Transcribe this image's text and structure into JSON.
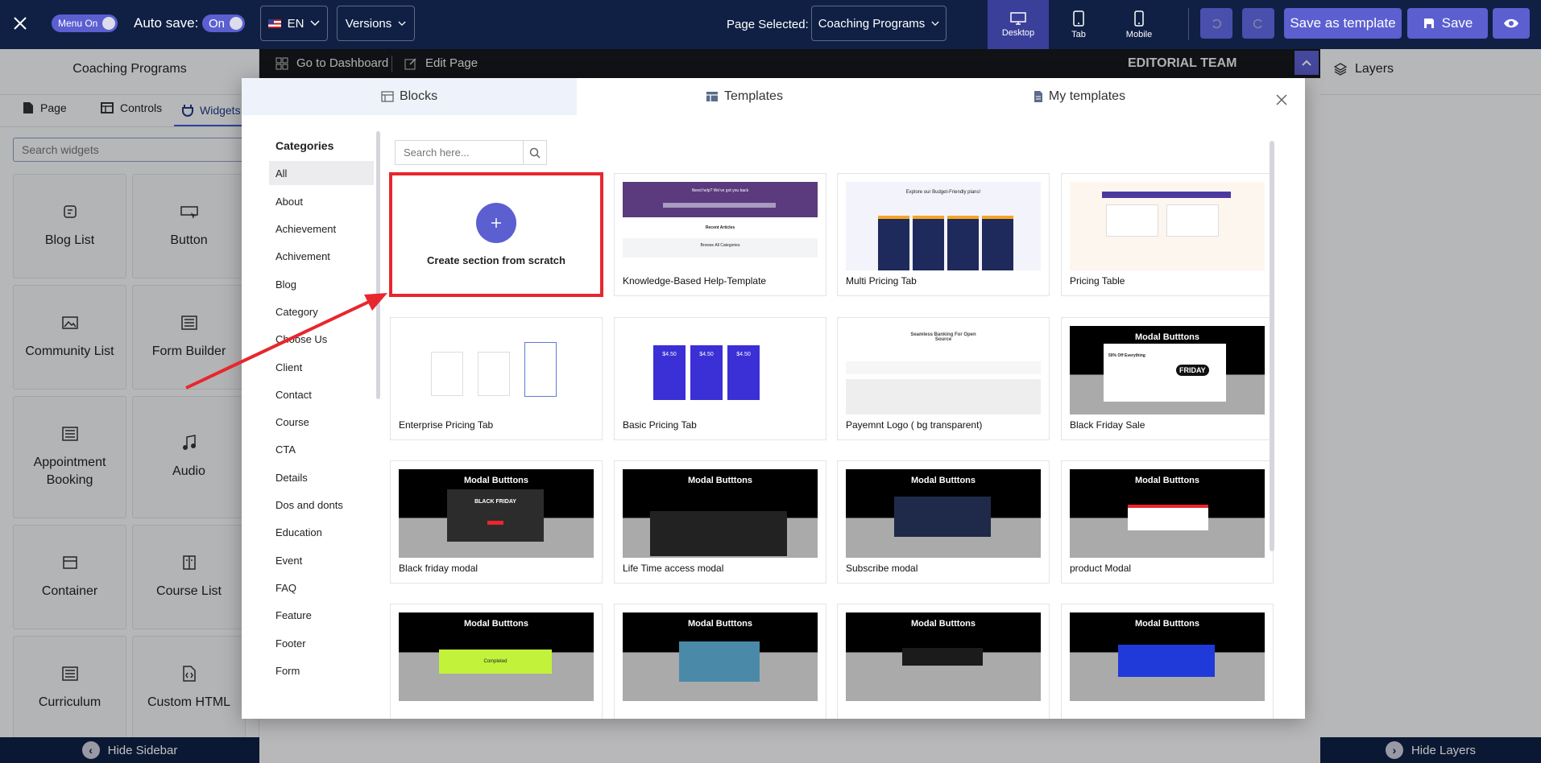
{
  "topbar": {
    "menu_on": "Menu On",
    "auto_save": "Auto save:",
    "on": "On",
    "lang": "EN",
    "versions": "Versions",
    "page_selected": "Page Selected:",
    "page_name": "Coaching Programs",
    "desktop": "Desktop",
    "tab": "Tab",
    "mobile": "Mobile",
    "save_template": "Save as template",
    "save": "Save"
  },
  "sidebar": {
    "title": "Coaching Programs",
    "tabs": [
      "Page",
      "Controls",
      "Widgets"
    ],
    "search_placeholder": "Search widgets",
    "widgets": [
      "Blog List",
      "Button",
      "Community List",
      "Form Builder",
      "Appointment Booking",
      "Audio",
      "Container",
      "Course List",
      "Curriculum",
      "Custom HTML"
    ],
    "hide": "Hide Sidebar"
  },
  "editor": {
    "dashboard": "Go to Dashboard",
    "edit": "Edit Page",
    "brand": "EDITORIAL TEAM"
  },
  "right": {
    "layers": "Layers",
    "hide": "Hide Layers"
  },
  "modal": {
    "tabs": [
      "Blocks",
      "Templates",
      "My templates"
    ],
    "categories_title": "Categories",
    "categories": [
      "All",
      "About",
      "Achievement",
      "Achivement",
      "Blog",
      "Category",
      "Choose Us",
      "Client",
      "Contact",
      "Course",
      "CTA",
      "Details",
      "Dos and donts",
      "Education",
      "Event",
      "FAQ",
      "Feature",
      "Footer",
      "Form"
    ],
    "search_placeholder": "Search here...",
    "create": "Create section from scratch",
    "cards": [
      "Knowledge-Based Help-Template",
      "Multi Pricing Tab",
      "Pricing Table",
      "Enterprise Pricing Tab",
      "Basic Pricing Tab",
      "Payemnt Logo ( bg transparent)",
      "Black Friday Sale",
      "Black friday modal",
      "Life Time access modal",
      "Subscribe modal",
      "product Modal"
    ]
  },
  "thumbs": {
    "help_head": "Need help? We've got you back",
    "recent": "Recent Articles",
    "browse": "Browse All Categories",
    "budget": "Explore our Budget-Friendly plans!",
    "price": "$4.50",
    "seamless": "Seamless Banking For Open Source",
    "modal_buttons": "Modal Butttons",
    "black_friday": "BLACK FRIDAY",
    "friday": "FRIDAY",
    "off": "50% Off Everything",
    "completed": "Completed"
  },
  "colors": {
    "navy": "#0f2044",
    "accent": "#5b5fd0",
    "highlight": "#e8262d"
  }
}
